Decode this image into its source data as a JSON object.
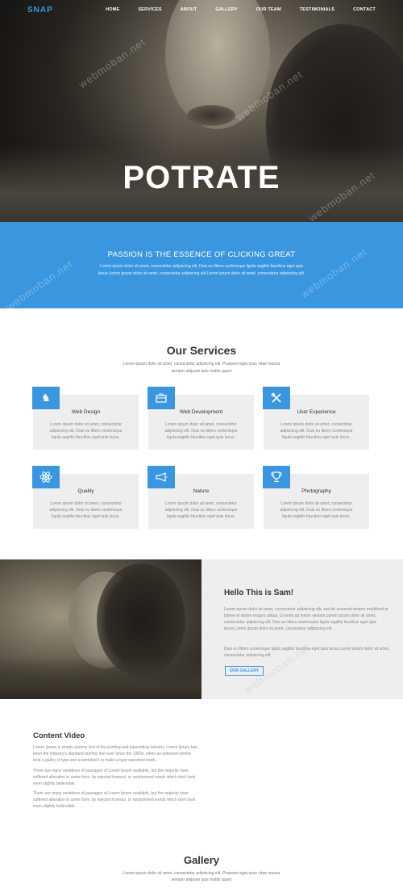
{
  "header": {
    "logo": "SNAP",
    "nav": [
      "HOME",
      "SERVICES",
      "ABOUT",
      "GALLERY",
      "OUR TEAM",
      "TESTIMONIALS",
      "CONTACT"
    ]
  },
  "hero": {
    "title": "POTRATE"
  },
  "band": {
    "title": "PASSION IS THE ESSENCE OF CLICKING GREAT",
    "text": "Lorem ipsum dolor sit amet, consectetur adipiscing elit. Duis eu libero scelerisque ligula sagittis faucibus eget quis lacus.Lorem ipsum dolor sit amet, consectetur adipiscing elit.Lorem ipsum dolor sit amet, consectetur adipiscing elit."
  },
  "services": {
    "heading": "Our Services",
    "subtitle": "Lorem ipsum dolor sit amet, consectetur adipiscing elit. Praesent eget risus vitae massa semper aliquam quis mattis quam",
    "items": [
      {
        "title": "Web Design",
        "text": "Lorem ipsum dolor sit amet, consectetur adipiscing elit. Duis eu libero scelerisque ligula sagittis faucibus eget quis lacus.",
        "icon": "knight-icon"
      },
      {
        "title": "Web Development",
        "text": "Lorem ipsum dolor sit amet, consectetur adipiscing elit. Duis eu libero scelerisque ligula sagittis faucibus eget quis lacus.",
        "icon": "briefcase-icon"
      },
      {
        "title": "User Experience",
        "text": "Lorem ipsum dolor sit amet, consectetur adipiscing elit. Duis eu libero scelerisque ligula sagittis faucibus eget quis lacus.",
        "icon": "tools-icon"
      },
      {
        "title": "Quality",
        "text": "Lorem ipsum dolor sit amet, consectetur adipiscing elit. Duis eu libero scelerisque ligula sagittis faucibus eget quis lacus.",
        "icon": "atom-icon"
      },
      {
        "title": "Nature",
        "text": "Lorem ipsum dolor sit amet, consectetur adipiscing elit. Duis eu libero scelerisque ligula sagittis faucibus eget quis lacus.",
        "icon": "megaphone-icon"
      },
      {
        "title": "Photography",
        "text": "Lorem ipsum dolor sit amet, consectetur adipiscing elit. Duis eu libero scelerisque ligula sagittis faucibus eget quis lacus.",
        "icon": "trophy-icon"
      }
    ]
  },
  "about": {
    "title": "Hello This is Sam!",
    "p1": "Lorem ipsum dolor sit amet, consectetur adipiscing elit, sed do eiusmod tempor incididunt ut labore et dolore magna aliqua. Ut enim ad minim veniam.Lorem ipsum dolor sit amet, consectetur adipiscing elit. Duis eu libero scelerisque ligula sagittis faucibus eget quis lacus.Lorem ipsum dolor sit amet, consectetur adipiscing elit.",
    "p2": "Duis eu libero scelerisque ligula sagittis faucibus eget quis lacus.Lorem ipsum dolor sit amet, consectetur adipiscing elit.",
    "button": "OUR GALLERY"
  },
  "content_video": {
    "title": "Content Video",
    "paragraphs": [
      "Lorem Ipsum is simply dummy text of the printing and typesetting industry. Lorem Ipsum has been the industry's standard dummy text ever since the 1500s, when an unknown printer took a galley of type and scrambled it to make a type specimen book.",
      "There are many variations of passages of Lorem Ipsum available, but the majority have suffered alteration in some form, by injected humour, or randomised words which don't look even slightly believable.",
      "There are many variations of passages of Lorem Ipsum available, but the majority have suffered alteration in some form, by injected humour, or randomised words which don't look even slightly believable."
    ]
  },
  "gallery": {
    "heading": "Gallery",
    "subtitle": "Lorem ipsum dolor sit amet, consectetur adipiscing elit. Praesent eget risus vitae massa semper aliquam quis mattis quam"
  },
  "watermark": "webmoban.net",
  "colors": {
    "accent": "#3a97df",
    "card_bg": "#eeeeee"
  }
}
